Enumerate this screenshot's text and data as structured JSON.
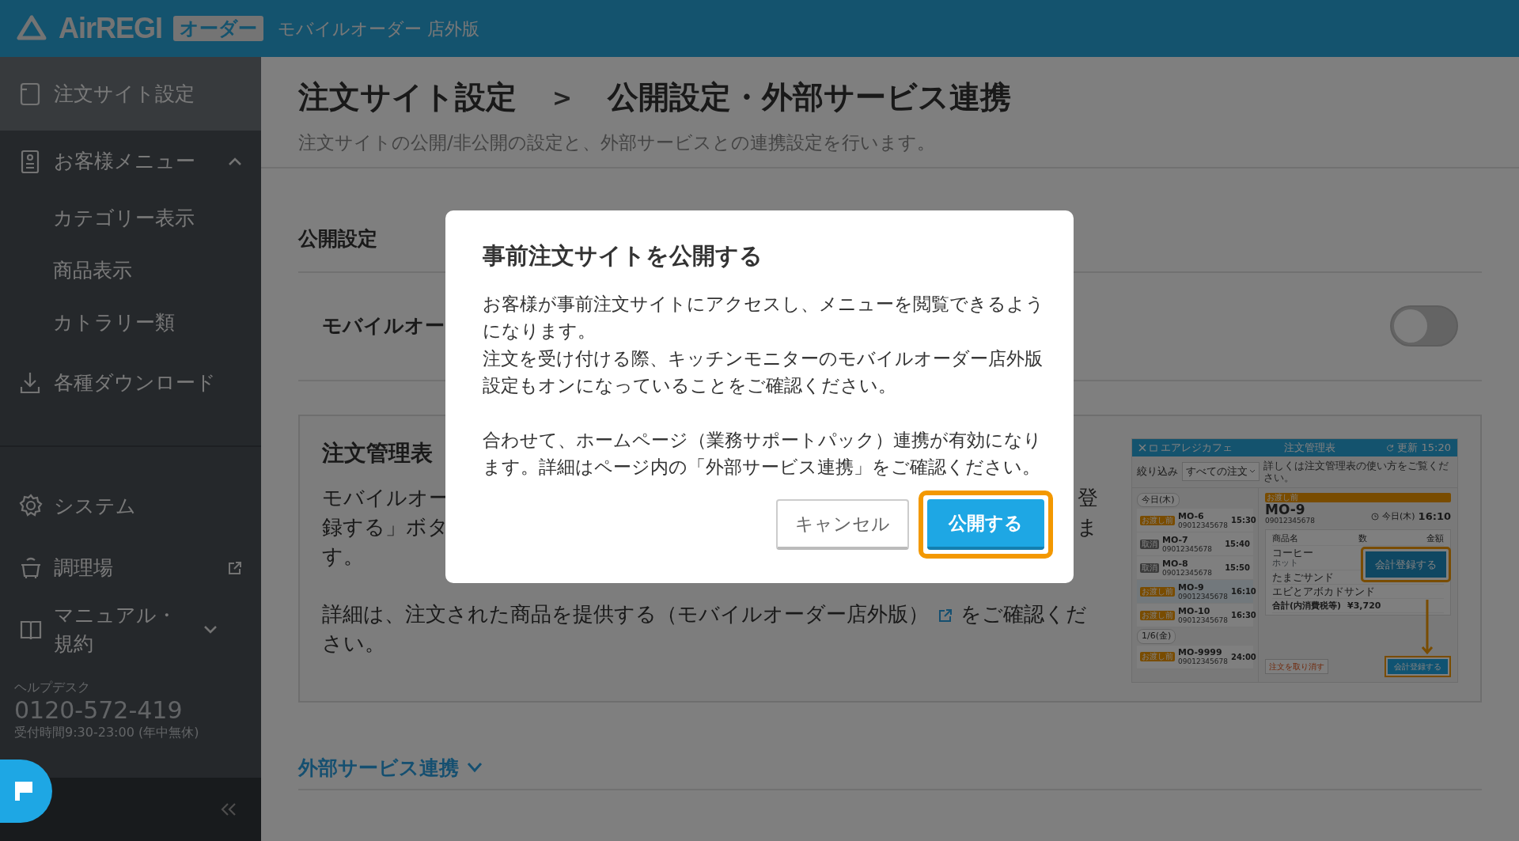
{
  "header": {
    "logo": "AirREGI",
    "logo_badge": "オーダー",
    "product": "モバイルオーダー 店外版"
  },
  "sidebar": {
    "main": [
      {
        "kind": "link",
        "label": "注文サイト設定",
        "selected": true
      },
      {
        "kind": "group",
        "label": "お客様メニュー",
        "selected": false,
        "expanded": true,
        "children": [
          {
            "label": "カテゴリー表示",
            "selected": false
          },
          {
            "label": "商品表示",
            "selected": false
          },
          {
            "label": "カトラリー類",
            "selected": false
          }
        ]
      },
      {
        "kind": "link",
        "label": "各種ダウンロード",
        "selected": false
      }
    ],
    "sub": [
      {
        "kind": "link",
        "label": "システム",
        "selected": false
      },
      {
        "kind": "external",
        "label": "調理場",
        "selected": false
      },
      {
        "kind": "group",
        "label": "マニュアル・規約",
        "selected": false,
        "expanded": false
      }
    ],
    "help": {
      "label": "ヘルプデスク",
      "phone": "0120-572-419",
      "hours": "受付時間9:30-23:00 (年中無休)"
    }
  },
  "page": {
    "breadcrumb": {
      "link": "注文サイト設定",
      "separator": ">",
      "current": "公開設定・外部サービス連携"
    },
    "description": "注文サイトの公開/非公開の設定と、外部サービスとの連携設定を行います。",
    "publish": {
      "heading": "公開設定",
      "row_label": "モバイルオー",
      "on": false
    },
    "card": {
      "heading": "注文管理表",
      "lines": [
        {
          "left": "モバイルオー",
          "right": "登"
        },
        {
          "left": "録する」ボタ",
          "right": "ま"
        },
        {
          "left": "す。"
        }
      ],
      "detail": {
        "before": "詳細は、",
        "link": "注文された商品を提供する（モバイルオーダー店外版）",
        "after": "をご確認ください。"
      }
    },
    "external": {
      "label": "外部サービス連携",
      "expanded": false
    }
  },
  "order_screen": {
    "title": "注文管理表",
    "store": "エアレジカフェ",
    "updated": "更新 15:20",
    "filter_label": "絞り込み",
    "filter_value": "すべての注文",
    "hint": "詳しくは注文管理表の使い方をご覧ください。",
    "groups": [
      {
        "date": "今日(木)",
        "orders": [
          {
            "id": "MO-6",
            "phone": "09012345678",
            "time": "15:30",
            "status": "お渡し前",
            "kind": "pending",
            "selected": false
          },
          {
            "id": "MO-7",
            "phone": "09012345678",
            "time": "15:40",
            "status": "取消",
            "kind": "cancelled",
            "selected": false
          },
          {
            "id": "MO-8",
            "phone": "09012345678",
            "time": "15:50",
            "status": "取消",
            "kind": "cancelled",
            "selected": false
          },
          {
            "id": "MO-9",
            "phone": "09012345678",
            "time": "16:10",
            "status": "お渡し前",
            "kind": "pending",
            "selected": true
          },
          {
            "id": "MO-10",
            "phone": "09012345678",
            "time": "16:30",
            "status": "お渡し前",
            "kind": "pending",
            "selected": false
          }
        ]
      },
      {
        "date": "1/6(金)",
        "orders": [
          {
            "id": "MO-9999",
            "phone": "09012345678",
            "time": "24:00",
            "status": "お渡し前",
            "kind": "pending",
            "selected": false
          }
        ]
      }
    ],
    "detail": {
      "status": "お渡し前",
      "id": "MO-9",
      "phone": "09012345678",
      "day": "今日(木)",
      "time": "16:10",
      "columns": [
        "商品名",
        "数",
        "金額"
      ],
      "items": [
        {
          "name": "コーヒー",
          "sub": "ホット"
        },
        {
          "name": "たまごサンド"
        },
        {
          "name": "エビとアボカドサンド"
        }
      ],
      "total_label": "合計(内消費税等)",
      "total_value": "¥3,720",
      "cancel": "注文を取り消す",
      "register": "会計登録する",
      "callout": "会計登録する"
    }
  },
  "modal": {
    "title": "事前注文サイトを公開する",
    "paragraphs": [
      "お客様が事前注文サイトにアクセスし、メニューを閲覧できるようになります。",
      "注文を受け付ける際、キッチンモニターのモバイルオーダー店外版設定もオンになっていることをご確認ください。",
      "合わせて、ホームページ（業務サポートパック）連携が有効になります。詳細はページ内の「外部サービス連携」をご確認ください。"
    ],
    "cancel": "キャンセル",
    "confirm": "公開する",
    "confirm_highlighted": true
  }
}
